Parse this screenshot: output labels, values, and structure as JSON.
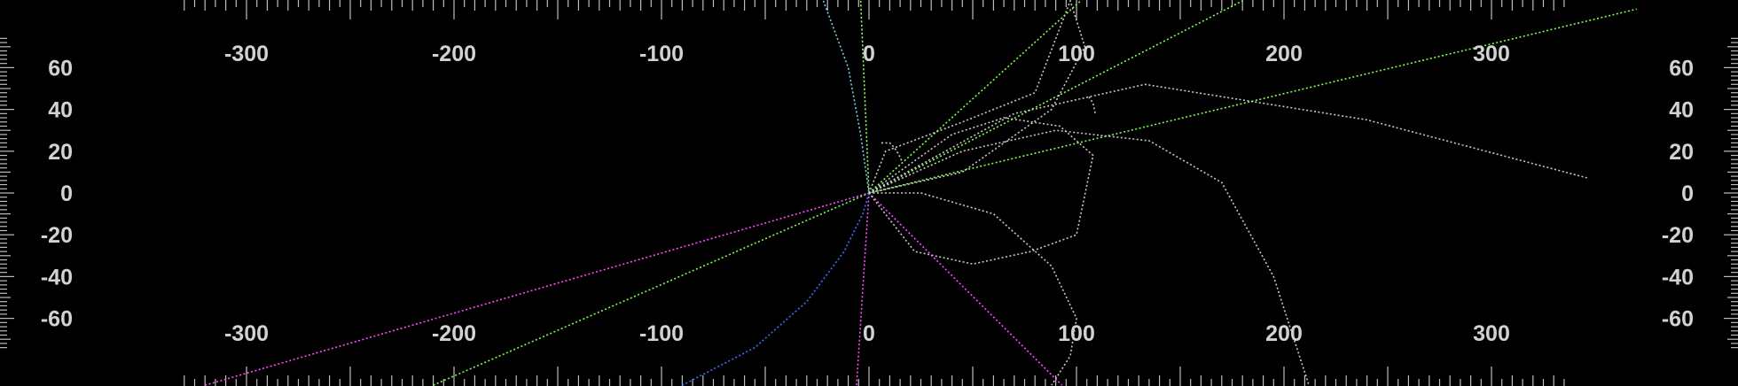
{
  "chart_data": {
    "type": "line",
    "title": "",
    "xlabel": "",
    "ylabel": "",
    "xlim": [
      -410,
      420
    ],
    "ylim": [
      -92,
      92
    ],
    "grid": false,
    "x_tick_labels": [
      "-300",
      "-200",
      "-100",
      "0",
      "100",
      "200",
      "300"
    ],
    "y_tick_labels": [
      "60",
      "40",
      "20",
      "0",
      "-20",
      "-40",
      "-60"
    ],
    "colors": {
      "background": "#000000",
      "text": "#d2d2d2",
      "ticks": "#bdbdbd"
    },
    "series": [
      {
        "color": "#7cff50",
        "x": [
          0,
          102
        ],
        "y": [
          0,
          92
        ]
      },
      {
        "color": "#7cff50",
        "x": [
          0,
          180
        ],
        "y": [
          0,
          92
        ]
      },
      {
        "color": "#7cff50",
        "x": [
          -210,
          0,
          370
        ],
        "y": [
          -92,
          0,
          88
        ]
      },
      {
        "color": "#9aff6e",
        "x": [
          -4,
          0
        ],
        "y": [
          92,
          0
        ]
      },
      {
        "color": "#ff4dff",
        "x": [
          -320,
          0
        ],
        "y": [
          -92,
          0
        ]
      },
      {
        "color": "#ff4dff",
        "x": [
          0,
          93
        ],
        "y": [
          0,
          -92
        ]
      },
      {
        "color": "#ff4dff",
        "x": [
          -6,
          0
        ],
        "y": [
          -92,
          0
        ]
      },
      {
        "color": "#3a70ff",
        "x": [
          -90,
          -55,
          -30,
          -12,
          -3,
          0
        ],
        "y": [
          -92,
          -74,
          -52,
          -28,
          -10,
          0
        ]
      },
      {
        "color": "#7ad0e8",
        "x": [
          -22,
          -10,
          -4,
          0
        ],
        "y": [
          92,
          60,
          28,
          0
        ]
      },
      {
        "color": "#c8c8c8",
        "x": [
          0,
          40,
          65,
          92,
          108,
          100,
          78,
          50,
          22,
          0
        ],
        "y": [
          0,
          28,
          36,
          32,
          18,
          -20,
          -28,
          -34,
          -28,
          0
        ]
      },
      {
        "color": "#c8c8c8",
        "x": [
          0,
          25,
          60,
          88,
          100,
          97,
          88
        ],
        "y": [
          0,
          0,
          -10,
          -35,
          -60,
          -78,
          -92
        ]
      },
      {
        "color": "#c8c8c8",
        "x": [
          0,
          45,
          88,
          104,
          97,
          80,
          45,
          8,
          0
        ],
        "y": [
          0,
          10,
          40,
          70,
          92,
          48,
          34,
          20,
          0
        ]
      },
      {
        "color": "#c8c8c8",
        "x": [
          0,
          70,
          133,
          240,
          347
        ],
        "y": [
          0,
          38,
          52,
          35,
          7
        ]
      },
      {
        "color": "#c8c8c8",
        "x": [
          0,
          45,
          90,
          135,
          170,
          195,
          212
        ],
        "y": [
          0,
          20,
          30,
          25,
          5,
          -40,
          -92
        ]
      },
      {
        "color": "#c8c8c8",
        "x": [
          6,
          10,
          12,
          14,
          16
        ],
        "y": [
          24,
          24,
          22,
          19,
          15
        ]
      },
      {
        "color": "#c8c8c8",
        "x": [
          106,
          108,
          109
        ],
        "y": [
          46,
          43,
          38
        ]
      }
    ]
  }
}
